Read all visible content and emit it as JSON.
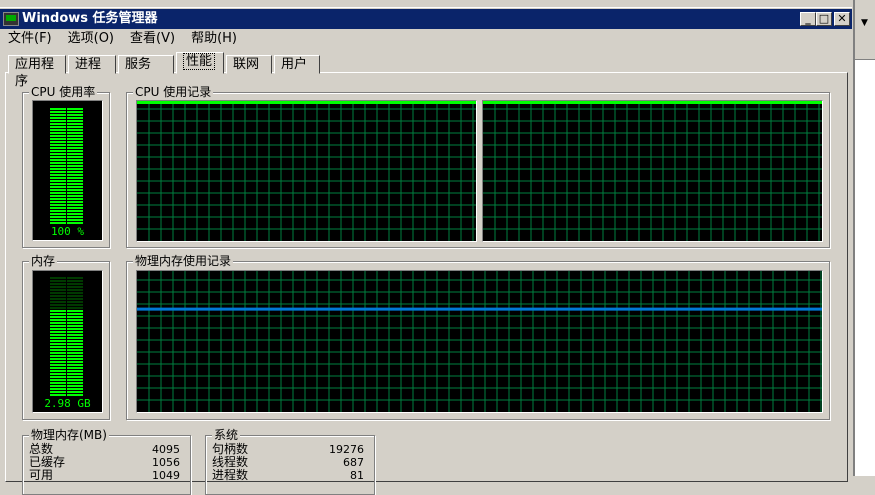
{
  "window": {
    "title": "Windows 任务管理器",
    "minimize": "_",
    "maximize": "□",
    "close": "✕"
  },
  "menu": [
    "文件(F)",
    "选项(O)",
    "查看(V)",
    "帮助(H)"
  ],
  "tabs": [
    {
      "label": "应用程序"
    },
    {
      "label": "进程"
    },
    {
      "label": "服务"
    },
    {
      "label": "性能",
      "active": true
    },
    {
      "label": "联网"
    },
    {
      "label": "用户"
    }
  ],
  "cpu_usage": {
    "label": "CPU 使用率",
    "value_text": "100 %",
    "percent": 100
  },
  "cpu_history": {
    "label": "CPU 使用记录",
    "cores": [
      {
        "percent": 100
      },
      {
        "percent": 100
      }
    ]
  },
  "memory": {
    "label": "内存",
    "value_text": "2.98 GB",
    "percent": 73
  },
  "memory_history": {
    "label": "物理内存使用记录",
    "percent": 73
  },
  "physical_memory": {
    "label": "物理内存(MB)",
    "rows": [
      {
        "label": "总数",
        "value": "4095"
      },
      {
        "label": "已缓存",
        "value": "1056"
      },
      {
        "label": "可用",
        "value": "1049"
      }
    ]
  },
  "system": {
    "label": "系统",
    "rows": [
      {
        "label": "句柄数",
        "value": "19276"
      },
      {
        "label": "线程数",
        "value": "687"
      },
      {
        "label": "进程数",
        "value": "81"
      }
    ]
  },
  "colors": {
    "title_bar": "#0a246a",
    "grid": "#008040",
    "cpu_line": "#00ff00",
    "memory_line": "#0078d7",
    "meter": "#00ff00"
  }
}
